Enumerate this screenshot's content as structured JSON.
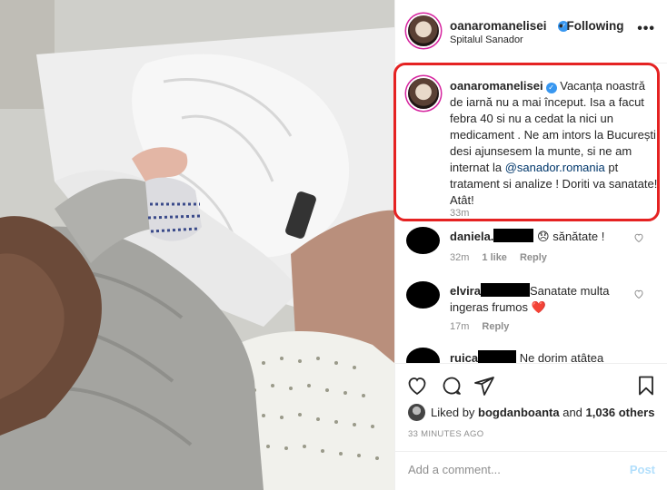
{
  "header": {
    "username": "oanaromanelisei",
    "separator": "•",
    "follow_status": "Following",
    "location": "Spitalul Sanador",
    "more": "•••"
  },
  "caption": {
    "username": "oanaromanelisei",
    "text_before_mention": "Vacanța noastră de iarnă nu a mai început. Isa a facut febra 40 si nu a cedat la nici un medicament . Ne am intors la București, desi ajunsesem la munte, si ne am internat la ",
    "mention": "@sanador.romania",
    "text_after_mention": " pt tratament si analize ! Doriti va sanatate! Atât!",
    "time": "33m"
  },
  "comments": [
    {
      "username": "daniela.",
      "text": "😞 sănătate !",
      "time": "32m",
      "likes": "1 like",
      "reply": "Reply"
    },
    {
      "username": "elvira",
      "text": "Sanatate multa ingeras frumos ❤️",
      "time": "17m",
      "likes": "",
      "reply": "Reply"
    },
    {
      "username": "ruica",
      "text": "Ne dorim atâtea",
      "time": "",
      "likes": "",
      "reply": ""
    }
  ],
  "likes": {
    "prefix": "Liked by",
    "user": "bogdanboanta",
    "middle": "and",
    "others": "1,036 others"
  },
  "timestamp": "33 MINUTES AGO",
  "add_comment": {
    "placeholder": "Add a comment...",
    "post_label": "Post"
  },
  "colors": {
    "highlight": "#e52222",
    "verified": "#3897f0",
    "link": "#00376b",
    "post_disabled": "#b2dffc",
    "heart_red": "#ed4956"
  },
  "icons": [
    "heart-icon",
    "comment-icon",
    "share-icon",
    "bookmark-icon",
    "more-options-icon",
    "verified-badge-icon"
  ]
}
